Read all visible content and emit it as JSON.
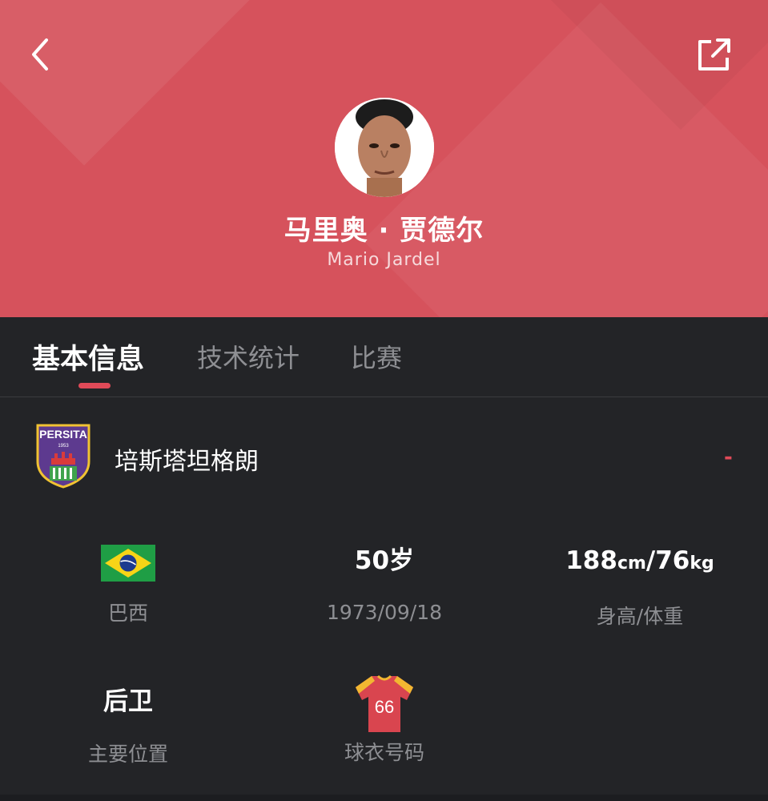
{
  "header": {
    "player_name": "马里奥 · 贾德尔",
    "player_name_en": "Mario Jardel",
    "back_icon": "chevron-left-icon",
    "share_icon": "share-icon",
    "accent_color": "#d6525c"
  },
  "tabs": [
    {
      "label": "基本信息",
      "active": true
    },
    {
      "label": "技术统计",
      "active": false
    },
    {
      "label": "比赛",
      "active": false
    }
  ],
  "team": {
    "name": "培斯塔坦格朗",
    "logo_text": "PERSITA",
    "logo_year": "1953",
    "extra": "-"
  },
  "info": {
    "nationality": {
      "value_icon": "brazil-flag-icon",
      "label": "巴西"
    },
    "age": {
      "value": "50岁",
      "label": "1973/09/18"
    },
    "body": {
      "height_num": "188",
      "height_unit": "cm",
      "sep": "/",
      "weight_num": "76",
      "weight_unit": "kg",
      "label": "身高/体重"
    },
    "position": {
      "value": "后卫",
      "label": "主要位置"
    },
    "jersey": {
      "number": "66",
      "label": "球衣号码"
    }
  }
}
